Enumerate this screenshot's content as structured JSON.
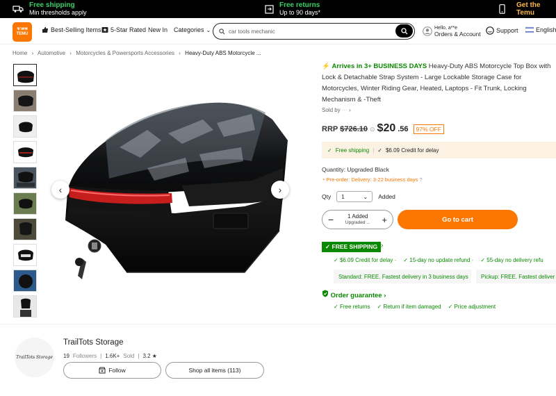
{
  "promo": {
    "free_shipping_title": "Free shipping",
    "free_shipping_sub": "Min thresholds apply",
    "free_returns_title": "Free returns",
    "free_returns_sub": "Up to 90 days*",
    "get_app": "Get the Temu"
  },
  "header": {
    "logo_top": "ขวดพ",
    "logo_bottom": "TEMU",
    "nav": [
      "Best-Selling Items",
      "5-Star Rated",
      "New In",
      "Categories"
    ],
    "search_value": "car tools mechanic",
    "account_line1": "Hello, a**e",
    "account_line2": "Orders & Account",
    "support": "Support",
    "language": "English"
  },
  "breadcrumb": [
    "Home",
    "Automotive",
    "Motorcycles & Powersports Accessories",
    "Heavy-Duty ABS Motorcycle ..."
  ],
  "product": {
    "arrival": "Arrives in 3+ BUSINESS DAYS",
    "title": "Heavy-Duty ABS Motorcycle Top Box with Lock & Detachable Strap System - Large Lockable Storage Case for Motorcycles, Winter Riding Gear, Heated, Laptops - Fit Trunk, Locking Mechanism & -Theft",
    "sold_by": "Sold by",
    "rrp_label": "RRP",
    "rrp_value": "$726.10",
    "price_main": "$20",
    "price_cents": ".56",
    "discount": "97% OFF",
    "ship_free": "Free shipping",
    "credit": "$6.09 Credit for delay",
    "quantity_label": "Quantity: Upgraded Black",
    "preorder": "Pre-order: Delivery: 3-22 business days",
    "qty_label": "Qty",
    "qty_value": "1",
    "added": "Added",
    "stepper_top": "1 Added",
    "stepper_bottom": "Upgraded ...",
    "cart_button": "Go to cart"
  },
  "shipping": {
    "badge": "FREE SHIPPING",
    "perks": [
      "$6.09 Credit for delay",
      "15-day no update refund",
      "55-day no delivery refu"
    ],
    "standard": "Standard: FREE. Fastest delivery in 3 business days",
    "pickup": "Pickup: FREE. Fastest deliver",
    "guarantee_title": "Order guarantee",
    "guarantee_items": [
      "Free returns",
      "Return if item damaged",
      "Price adjustment"
    ]
  },
  "store": {
    "logo_text": "TrailTots Storage",
    "name": "TrailTots Storage",
    "followers_value": "19",
    "followers_label": "Followers",
    "sold_value": "1.6K+",
    "sold_label": "Sold",
    "rating": "3.2 ★",
    "follow_button": "Follow",
    "shop_button": "Shop all items (113)"
  },
  "colors": {
    "accent": "#fb7701",
    "green": "#0a8800",
    "promo_bg": "#000000"
  }
}
